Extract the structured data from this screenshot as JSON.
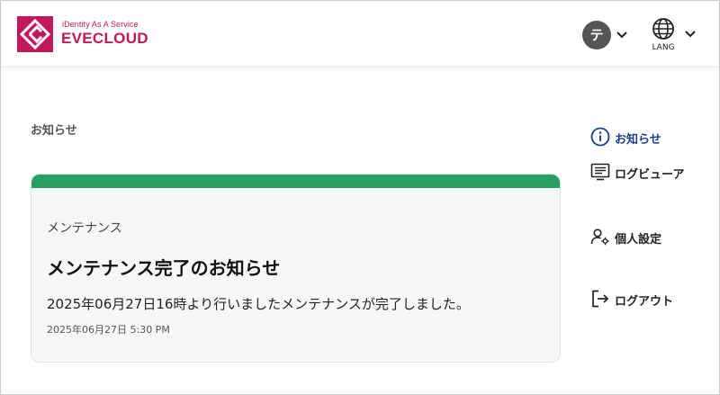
{
  "header": {
    "brand_tagline": "iDentity As A Service",
    "brand_name": "EVECLOUD",
    "user_initial": "テ",
    "lang_label": "LANG"
  },
  "page": {
    "title": "お知らせ"
  },
  "notice": {
    "category": "メンテナンス",
    "title": "メンテナンス完了のお知らせ",
    "body": "2025年06月27日16時より行いましたメンテナンスが完了しました。",
    "date": "2025年06月27日 5:30 PM",
    "accent_color": "#27a063"
  },
  "sidebar": {
    "items": [
      {
        "label": "お知らせ",
        "icon": "info-icon",
        "active": true
      },
      {
        "label": "ログビューア",
        "icon": "log-viewer-icon",
        "active": false
      },
      {
        "label": "個人設定",
        "icon": "user-settings-icon",
        "active": false
      },
      {
        "label": "ログアウト",
        "icon": "logout-icon",
        "active": false
      }
    ]
  },
  "colors": {
    "brand": "#c2185b",
    "active_nav": "#1a3f8f",
    "avatar_bg": "#555555"
  }
}
